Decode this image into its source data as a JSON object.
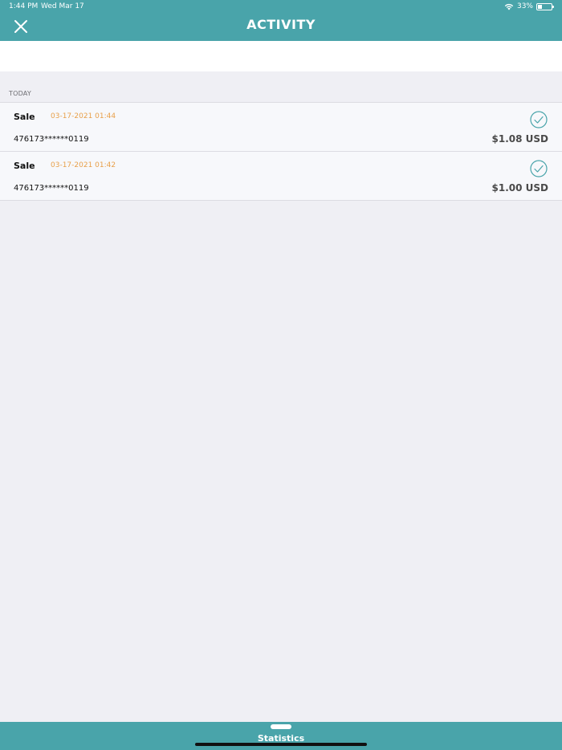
{
  "status": {
    "time": "1:44 PM",
    "date": "Wed Mar 17",
    "battery_text": "33%",
    "battery_level": 0.33
  },
  "header": {
    "title": "ACTIVITY",
    "close_icon": "close-icon"
  },
  "search": {
    "placeholder": ""
  },
  "section": {
    "label": "TODAY"
  },
  "transactions": [
    {
      "type": "Sale",
      "datetime": "03-17-2021  01:44",
      "card": "476173******0119",
      "amount": "$1.08 USD",
      "status_icon": "check-circle-icon"
    },
    {
      "type": "Sale",
      "datetime": "03-17-2021  01:42",
      "card": "476173******0119",
      "amount": "$1.00 USD",
      "status_icon": "check-circle-icon"
    }
  ],
  "bottom": {
    "label": "Statistics"
  },
  "colors": {
    "accent": "#49a4aa",
    "date_text": "#e8a04a",
    "background": "#efeff4",
    "row_background": "#f7f8fb"
  }
}
